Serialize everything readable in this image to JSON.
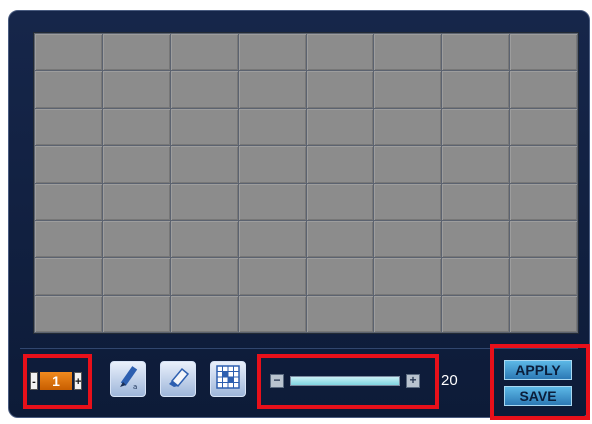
{
  "grid": {
    "rows": 8,
    "columns": 8
  },
  "stepper": {
    "value": "1",
    "minus_label": "-",
    "plus_label": "+"
  },
  "tools": [
    {
      "name": "pencil-icon"
    },
    {
      "name": "eraser-icon"
    },
    {
      "name": "grid-select-icon"
    }
  ],
  "slider": {
    "minus_label": "−",
    "plus_label": "+",
    "level": 1.0
  },
  "sensitivity_value": "20",
  "buttons": {
    "apply": "APPLY",
    "save": "SAVE"
  },
  "colors": {
    "frame": "#16264a",
    "cell": "#8c8c8c",
    "highlight": "#e8101a",
    "stepper_value": "#f08a1e",
    "action_button": "#2c79b5"
  }
}
